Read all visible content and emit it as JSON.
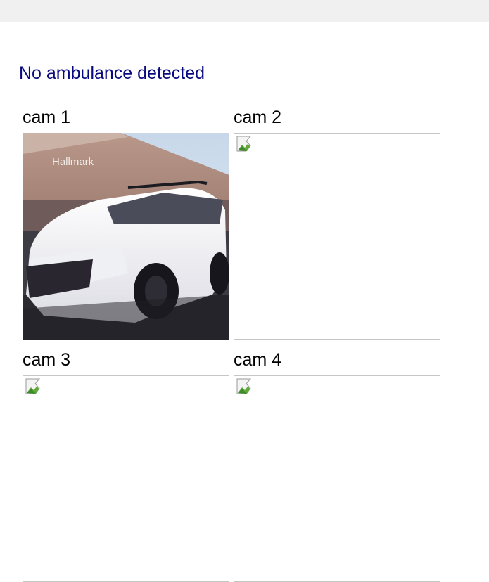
{
  "status": {
    "text": "No ambulance detected",
    "color": "#0a0a80"
  },
  "cameras": [
    {
      "label": "cam 1",
      "has_image": true,
      "store_sign": "Hallmark"
    },
    {
      "label": "cam 2",
      "has_image": false
    },
    {
      "label": "cam 3",
      "has_image": false
    },
    {
      "label": "cam 4",
      "has_image": false
    }
  ]
}
